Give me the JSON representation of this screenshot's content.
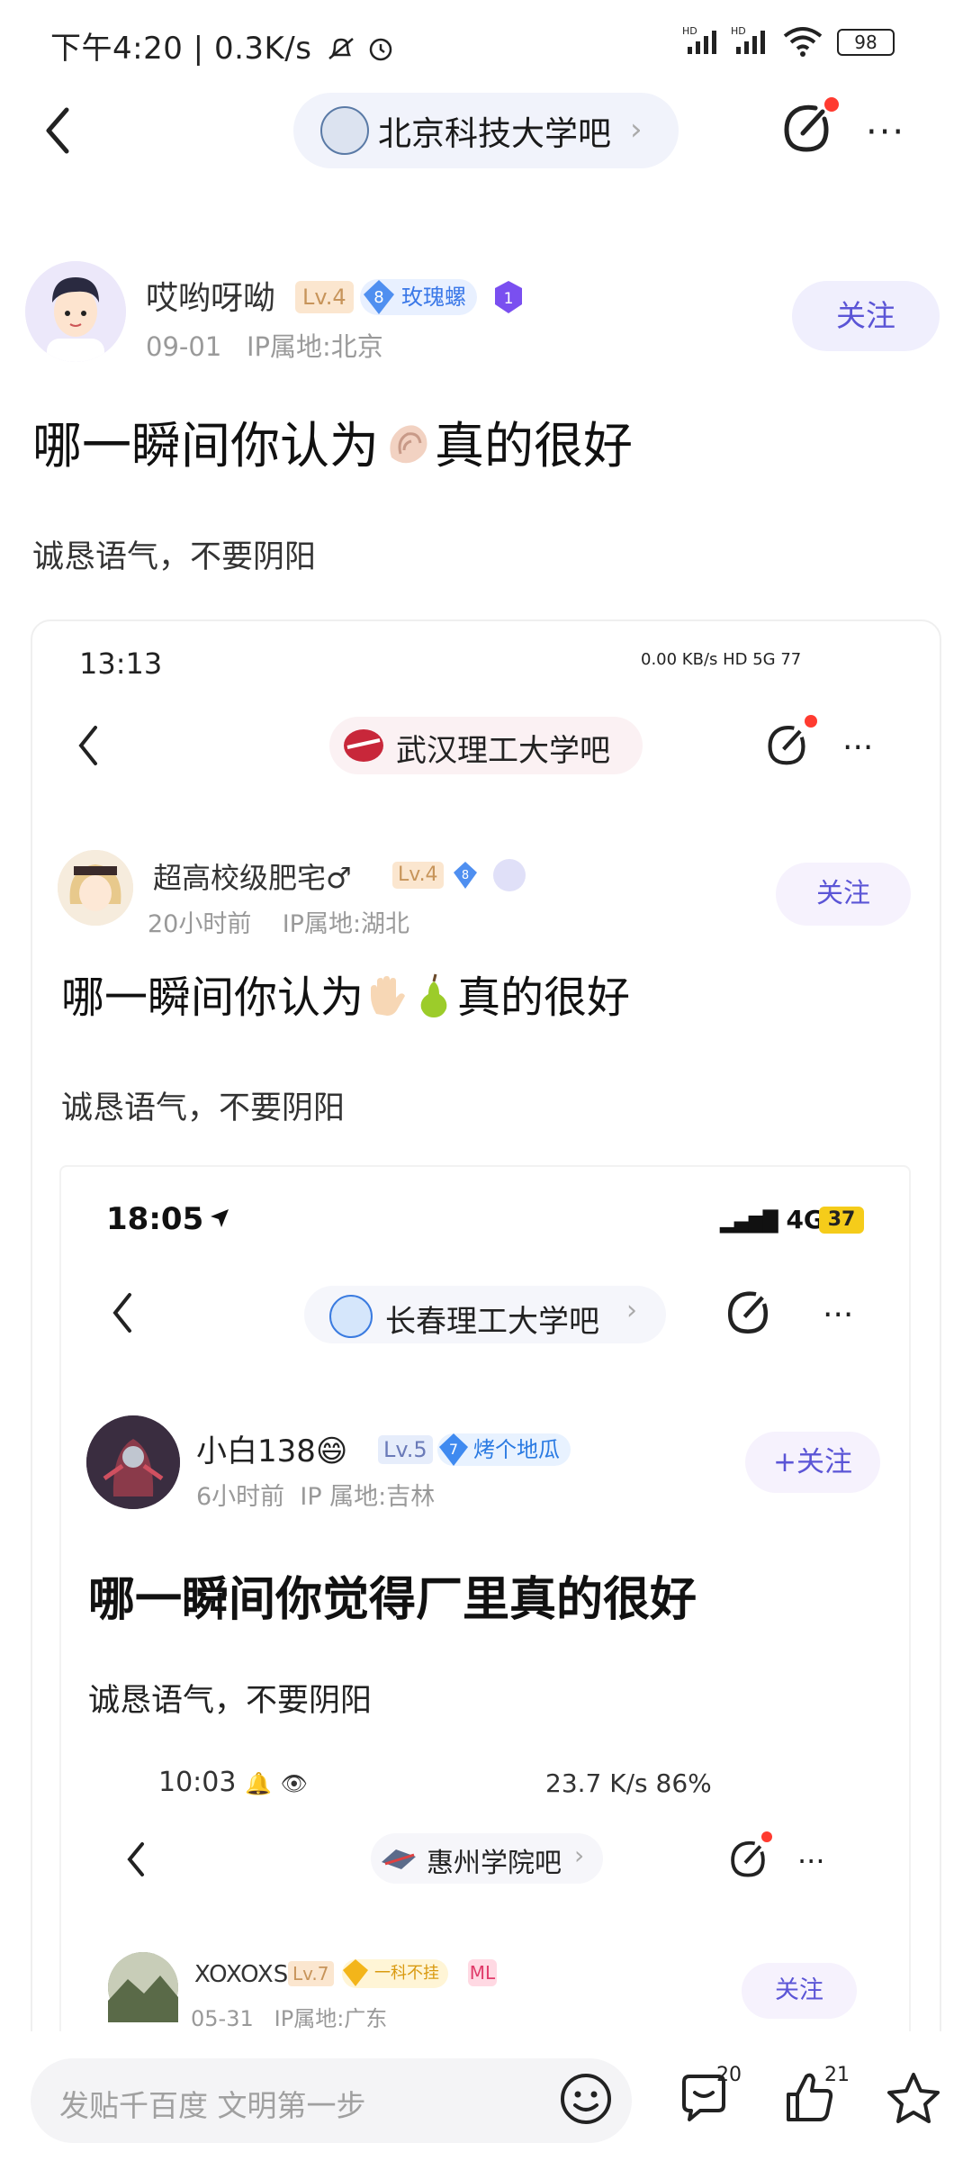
{
  "status_bar": {
    "time": "下午4:20",
    "speed": "0.3K/s",
    "battery": "98"
  },
  "header": {
    "forum_name": "北京科技大学吧",
    "chevron": "›",
    "more": "···"
  },
  "post": {
    "author": "哎哟呀呦",
    "level": "Lv.4",
    "diamond_level": "8",
    "diamond_label": "玫瑰螺",
    "purple_badge": "1",
    "date": "09-01",
    "ip": "IP属地:北京",
    "follow_label": "关注",
    "title_prefix": "哪一瞬间你认为",
    "title_suffix": "真的很好",
    "body": "诚恳语气，不要阴阳"
  },
  "shot1": {
    "time": "13:13",
    "status_text": "0.00 KB/s  HD  5G  77",
    "forum_name": "武汉理工大学吧",
    "more": "···",
    "author": "超高校级肥宅♂",
    "level": "Lv.4",
    "diamond_level": "8",
    "meta_time": "20小时前",
    "meta_ip": "IP属地:湖北",
    "follow_label": "关注",
    "title_prefix": "哪一瞬间你认为",
    "title_suffix": "真的很好",
    "body": "诚恳语气，不要阴阳"
  },
  "shot2": {
    "time": "18:05",
    "network": "4G",
    "battery": "37",
    "forum_name": "长春理工大学吧",
    "chevron": "›",
    "more": "···",
    "author": "小白138😄",
    "level": "Lv.5",
    "diamond_level": "7",
    "diamond_label": "烤个地瓜",
    "meta_time": "6小时前",
    "meta_ip": "IP 属地:吉林",
    "follow_label": "+关注",
    "title": "哪一瞬间你觉得厂里真的很好",
    "body": "诚恳语气，不要阴阳"
  },
  "shot3": {
    "time": "10:03",
    "status_text": "23.7 K/s   86%",
    "forum_name": "惠州学院吧",
    "chevron": "›",
    "more": "···",
    "author": "XOXOXS",
    "level": "Lv.7",
    "diamond_label": "一科不挂",
    "pbadge": "ML",
    "meta_time": "05-31",
    "meta_ip": "IP属地:广东",
    "follow_label": "关注"
  },
  "bottom_bar": {
    "reply_placeholder": "发贴千百度 文明第一步",
    "comment_count": "20",
    "like_count": "21"
  },
  "colors": {
    "accent": "#5b55d6",
    "level_badge": "#fbe6cf",
    "notification_dot": "#ff3b30"
  }
}
